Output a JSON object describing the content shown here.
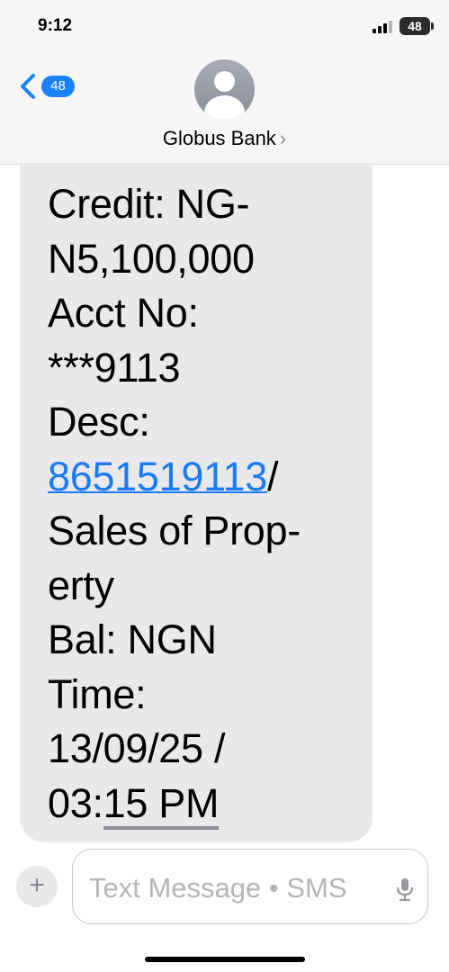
{
  "status_bar": {
    "time": "9:12",
    "battery": "48"
  },
  "header": {
    "back_count": "48",
    "contact_name": "Globus Bank",
    "chevron": "›",
    "avatar_icon": "person-silhouette-icon"
  },
  "message": {
    "lines": [
      "Credit: NG-",
      "N5,100,000",
      "Acct No:",
      "***9113",
      "Desc:",
      "8651519113",
      "/",
      "Sales of Prop-",
      "erty",
      "Bal: NGN",
      "Time:",
      "13/09/25 /",
      "03:",
      "15 PM"
    ],
    "link_color": "#1a7bf6"
  },
  "composer": {
    "plus": "+",
    "placeholder": "Text Message • SMS"
  },
  "colors": {
    "accent": "#1a82fb",
    "bubble": "#e9e9eb",
    "header_bg": "#f6f6f6"
  }
}
